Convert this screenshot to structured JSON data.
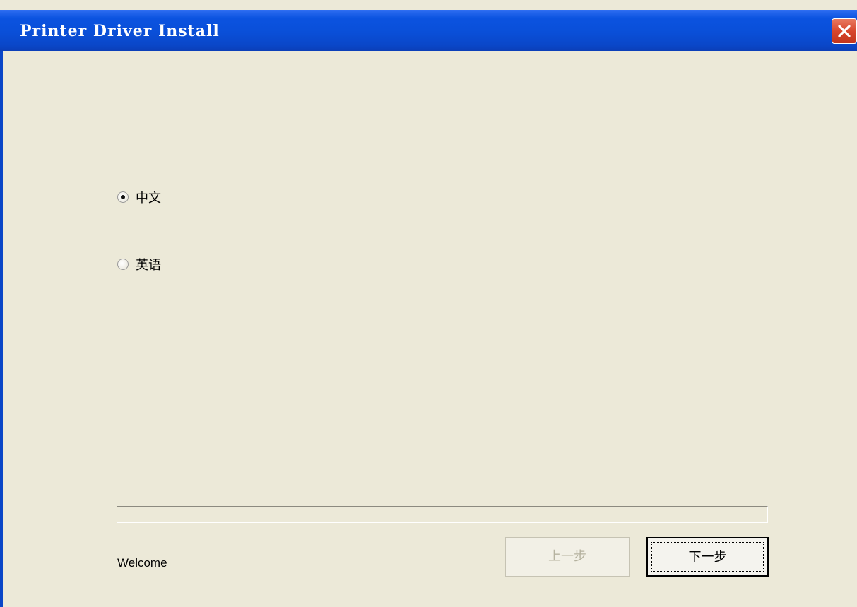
{
  "window": {
    "title": "Printer Driver Install"
  },
  "language_options": [
    {
      "label": "中文",
      "checked": true
    },
    {
      "label": "英语",
      "checked": false
    }
  ],
  "progress": {
    "value_percent": 0
  },
  "status": {
    "text": "Welcome"
  },
  "buttons": {
    "prev_label": "上一步",
    "next_label": "下一步"
  },
  "colors": {
    "titlebar": "#0a4fd8",
    "background": "#ece9d8",
    "close_button": "#d8462c"
  }
}
